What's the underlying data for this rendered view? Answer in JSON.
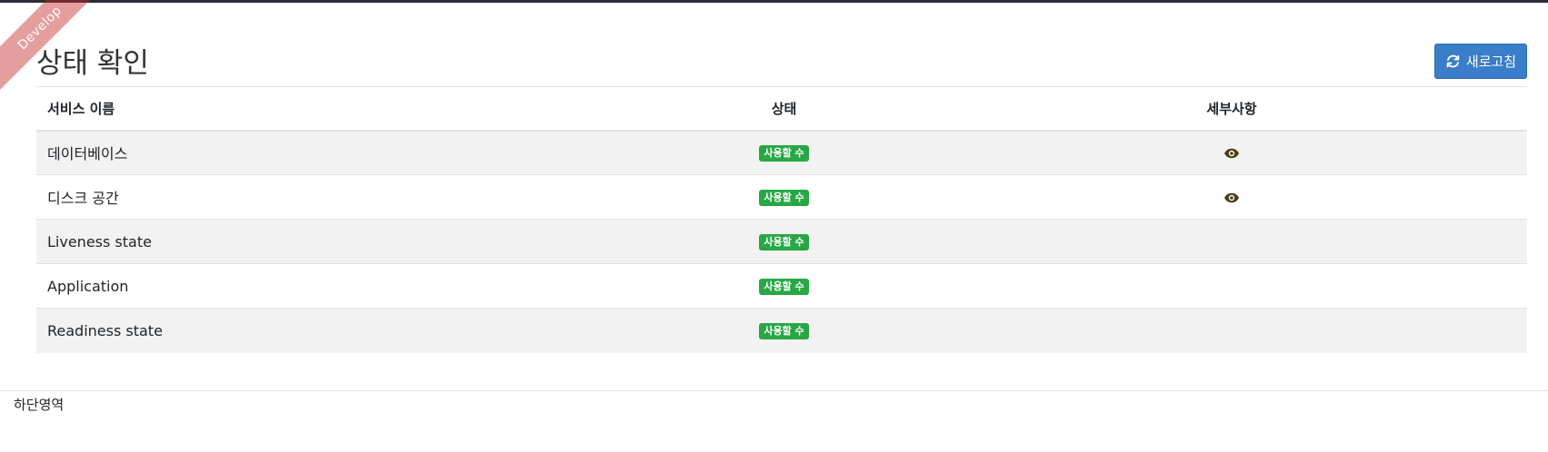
{
  "ribbon": {
    "text": "Develop"
  },
  "header": {
    "title": "상태 확인",
    "refresh_label": "새로고침",
    "refresh_icon": "refresh-icon",
    "refresh_color": "#3a7dc9"
  },
  "table": {
    "columns": [
      "서비스 이름",
      "상태",
      "세부사항"
    ],
    "rows": [
      {
        "name": "데이터베이스",
        "status": "사용할 수",
        "has_details": true
      },
      {
        "name": "디스크 공간",
        "status": "사용할 수",
        "has_details": true
      },
      {
        "name": "Liveness state",
        "status": "사용할 수",
        "has_details": false
      },
      {
        "name": "Application",
        "status": "사용할 수",
        "has_details": false
      },
      {
        "name": "Readiness state",
        "status": "사용할 수",
        "has_details": false
      }
    ],
    "status_color": "#28a745",
    "details_icon": "eye-icon"
  },
  "footer": {
    "text": "하단영역"
  }
}
